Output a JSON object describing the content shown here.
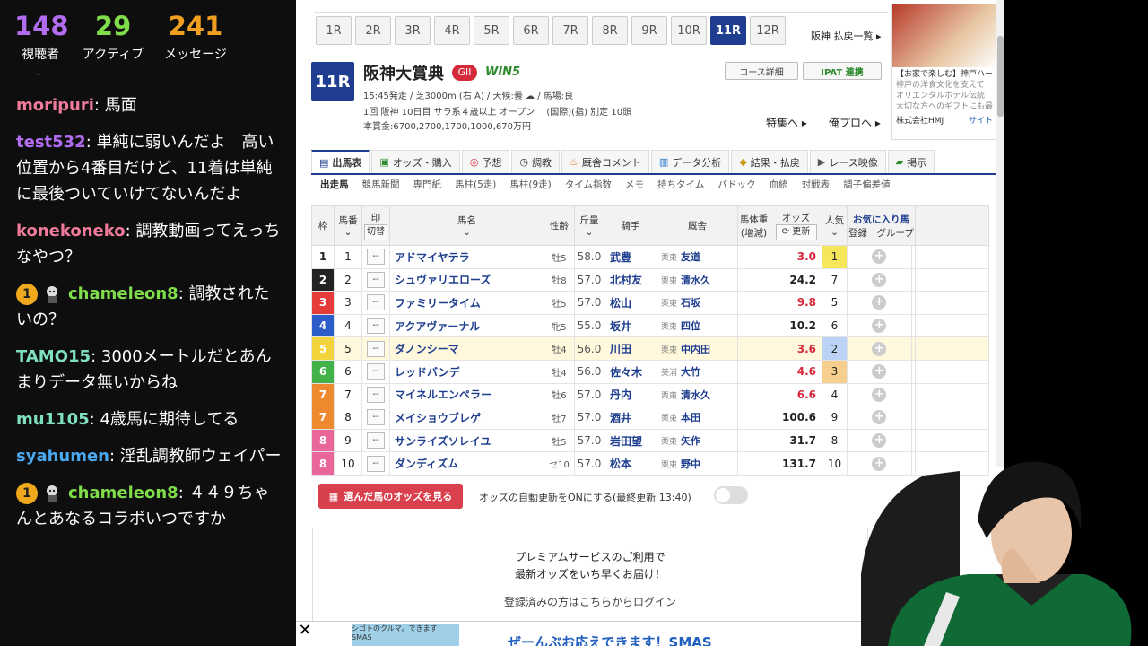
{
  "stats": {
    "viewers": {
      "value": "148",
      "label": "視聴者",
      "color": "#b26cf0"
    },
    "active": {
      "value": "29",
      "label": "アクティブ",
      "color": "#7fdc4a"
    },
    "messages": {
      "value": "241",
      "label": "メッセージ",
      "color": "#f0a020"
    }
  },
  "chat": [
    {
      "user": "",
      "text": "しょう",
      "color": "#ffffff"
    },
    {
      "user": "moripuri",
      "text": ": 馬面",
      "color": "#f07a9a"
    },
    {
      "user": "test532",
      "text": ": 単純に弱いんだよ　高い位置から4番目だけど、11着は単純に最後ついていけてないんだよ",
      "color": "#b26cf0"
    },
    {
      "user": "konekoneko",
      "text": ": 調教動画ってえっちなやつ？",
      "color": "#f07a9a"
    },
    {
      "badge": "1",
      "user": "chameleon8",
      "text": ": 調教されたいの？",
      "color": "#7fdc4a"
    },
    {
      "user": "TAMO15",
      "text": ": 3000メートルだとあんまりデータ無いからね",
      "color": "#7fe0c0"
    },
    {
      "user": "mu1105",
      "text": ": 4歳馬に期待してる",
      "color": "#7fe0c0"
    },
    {
      "user": "syahumen",
      "text": ": 淫乱調教師ウェイパー",
      "color": "#4aa8f0"
    },
    {
      "badge": "1",
      "user": "chameleon8",
      "text": ": ４４９ちゃんとあなるコラボいつですか",
      "color": "#7fdc4a"
    }
  ],
  "race_tabs": [
    "1R",
    "2R",
    "3R",
    "4R",
    "5R",
    "6R",
    "7R",
    "8R",
    "9R",
    "10R",
    "11R",
    "12R"
  ],
  "active_race": "11R",
  "list_link": "阪神 払戻一覧 ▸",
  "race": {
    "number": "11R",
    "name": "阪神大賞典",
    "grade": "GII",
    "win5": "WIN5",
    "line1": "15:45発走 / 芝3000m (右 A) / 天候:曇 ☁ / 馬場:良",
    "line2": "1回 阪神 10日目 サラ系４歳以上 オープン　 (国際)(指) 別定 10頭",
    "line3": "本賞金:6700,2700,1700,1000,670万円",
    "course_btn": "コース詳細",
    "ipat_btn": "IPAT 連携",
    "feature": "特集へ ▸",
    "ore_pro": "俺プロへ ▸"
  },
  "ad": {
    "text1": "【お家で楽しむ】神戸ハー",
    "text2": "神戸の洋食文化を支えて",
    "text3": "オリエンタルホテル伝統",
    "text4": "大切な方へのギフトにも最",
    "text5": "株式会社HMJ",
    "text6": "サイト"
  },
  "main_tabs": [
    "出馬表",
    "オッズ・購入",
    "予想",
    "調教",
    "厩舎コメント",
    "データ分析",
    "結果・払戻",
    "レース映像",
    "掲示"
  ],
  "sub_tabs": [
    "出走馬",
    "競馬新聞",
    "専門紙",
    "馬柱(5走)",
    "馬柱(9走)",
    "タイム指数",
    "メモ",
    "持ちタイム",
    "パドック",
    "血統",
    "対戦表",
    "調子偏差値"
  ],
  "table_headers": {
    "waku": "枠",
    "umaban": "馬番",
    "shirushi": "印",
    "kirikae": "切替",
    "name": "馬名",
    "sex_age": "性齢",
    "weight": "斤量",
    "jockey": "騎手",
    "trainer": "厩舎",
    "body_weight": "馬体重(増減)",
    "odds": "オッズ",
    "update": "更新",
    "popularity": "人気",
    "favorite": "お気に入り馬",
    "register": "登録",
    "group": "グループ"
  },
  "horses": [
    {
      "waku": "1",
      "waku_color": "#ffffff",
      "waku_text": "#222",
      "num": "1",
      "mark": "--",
      "name": "アドマイヤテラ",
      "sex": "牡5",
      "weight": "58.0",
      "jockey": "武豊",
      "region": "栗東",
      "trainer": "友道",
      "odds": "3.0",
      "pop": "1"
    },
    {
      "waku": "2",
      "waku_color": "#222222",
      "waku_text": "#fff",
      "num": "2",
      "mark": "--",
      "name": "シュヴァリエローズ",
      "sex": "牡8",
      "weight": "57.0",
      "jockey": "北村友",
      "region": "栗東",
      "trainer": "清水久",
      "odds": "24.2",
      "pop": "7"
    },
    {
      "waku": "3",
      "waku_color": "#e53b3b",
      "waku_text": "#fff",
      "num": "3",
      "mark": "--",
      "name": "ファミリータイム",
      "sex": "牡5",
      "weight": "57.0",
      "jockey": "松山",
      "region": "栗東",
      "trainer": "石坂",
      "odds": "9.8",
      "pop": "5"
    },
    {
      "waku": "4",
      "waku_color": "#2b5cc8",
      "waku_text": "#fff",
      "num": "4",
      "mark": "--",
      "name": "アクアヴァーナル",
      "sex": "牝5",
      "weight": "55.0",
      "jockey": "坂井",
      "region": "栗東",
      "trainer": "四位",
      "odds": "10.2",
      "pop": "6"
    },
    {
      "waku": "5",
      "waku_color": "#f2d53c",
      "waku_text": "#fff",
      "num": "5",
      "mark": "--",
      "name": "ダノンシーマ",
      "sex": "牡4",
      "weight": "56.0",
      "jockey": "川田",
      "region": "栗東",
      "trainer": "中内田",
      "odds": "3.6",
      "pop": "2"
    },
    {
      "waku": "6",
      "waku_color": "#43b14a",
      "waku_text": "#fff",
      "num": "6",
      "mark": "--",
      "name": "レッドバンデ",
      "sex": "牡4",
      "weight": "56.0",
      "jockey": "佐々木",
      "region": "美浦",
      "trainer": "大竹",
      "odds": "4.6",
      "pop": "3"
    },
    {
      "waku": "7",
      "waku_color": "#ef8a2e",
      "waku_text": "#fff",
      "num": "7",
      "mark": "--",
      "name": "マイネルエンペラー",
      "sex": "牡6",
      "weight": "57.0",
      "jockey": "丹内",
      "region": "栗東",
      "trainer": "清水久",
      "odds": "6.6",
      "pop": "4"
    },
    {
      "waku": "7",
      "waku_color": "#ef8a2e",
      "waku_text": "#fff",
      "num": "8",
      "mark": "--",
      "name": "メイショウブレゲ",
      "sex": "牡7",
      "weight": "57.0",
      "jockey": "酒井",
      "region": "栗東",
      "trainer": "本田",
      "odds": "100.6",
      "pop": "9"
    },
    {
      "waku": "8",
      "waku_color": "#e8669a",
      "waku_text": "#fff",
      "num": "9",
      "mark": "--",
      "name": "サンライズソレイユ",
      "sex": "牡5",
      "weight": "57.0",
      "jockey": "岩田望",
      "region": "栗東",
      "trainer": "矢作",
      "odds": "31.7",
      "pop": "8"
    },
    {
      "waku": "8",
      "waku_color": "#e8669a",
      "waku_text": "#fff",
      "num": "10",
      "mark": "--",
      "name": "ダンディズム",
      "sex": "セ10",
      "weight": "57.0",
      "jockey": "松本",
      "region": "栗東",
      "trainer": "野中",
      "odds": "131.7",
      "pop": "10"
    }
  ],
  "odds_button": "選んだ馬のオッズを見る",
  "auto_update": "オッズの自動更新をONにする(最終更新 13:40)",
  "premium": {
    "line1": "プレミアムサービスのご利用で",
    "line2": "最新オッズをいち早くお届け！",
    "login": "登録済みの方はこちらからログイン"
  },
  "bottom_ad": {
    "close": "✕",
    "thumb": "シゴトのクルマ。できます！SMAS",
    "title": "ぜーんぶお応えできます！SMAS"
  }
}
